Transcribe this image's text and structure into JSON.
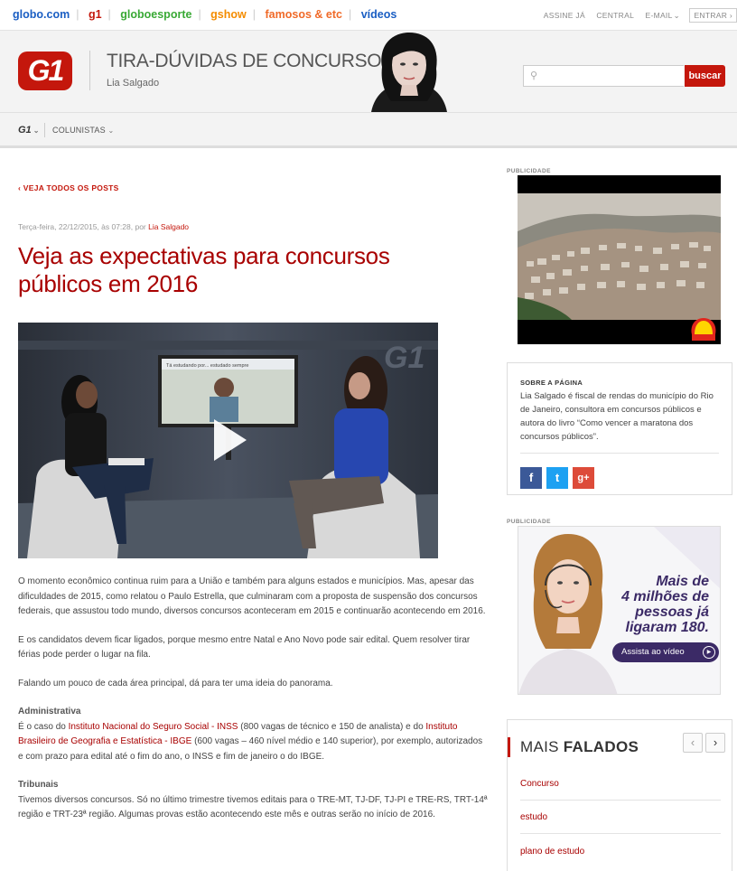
{
  "topbar": {
    "links": [
      {
        "label": "globo.com",
        "color": "#1a5ec3"
      },
      {
        "label": "g1",
        "color": "#c4170c"
      },
      {
        "label": "globoesporte",
        "color": "#39a935"
      },
      {
        "label": "gshow",
        "color": "#f48c00"
      },
      {
        "label": "famosos & etc",
        "color": "#f06a28"
      },
      {
        "label": "vídeos",
        "color": "#1a5ec3"
      }
    ],
    "right": [
      "ASSINE JÁ",
      "CENTRAL",
      "E-MAIL",
      "ENTRAR"
    ]
  },
  "header": {
    "logo": "G1",
    "blog_title": "TIRA-DÚVIDAS DE CONCURSOS",
    "author": "Lia Salgado",
    "search_placeholder": "",
    "search_button": "buscar"
  },
  "nav": {
    "g1": "G1",
    "colunistas": "COLUNISTAS"
  },
  "post": {
    "back": "‹ VEJA TODOS OS POSTS",
    "meta_date": "Terça-feira, 22/12/2015, às 07:28, por ",
    "meta_author": "Lia Salgado",
    "headline": "Veja as expectativas para concursos públicos em 2016",
    "video_screen_text": "Tá estudando por... estudado sempre",
    "paragraphs": [
      "O momento econômico continua ruim para a União e também para alguns estados e municípios. Mas, apesar das dificuldades de 2015, como relatou o Paulo Estrella, que culminaram com a proposta de suspensão dos concursos federais, que assustou todo mundo, diversos concursos aconteceram em 2015 e continuarão acontecendo em 2016.",
      "E os candidatos devem ficar ligados, porque mesmo entre Natal e Ano Novo pode sair edital. Quem resolver tirar férias pode perder o lugar na fila.",
      "Falando um pouco de cada área principal, dá para ter uma ideia do panorama."
    ],
    "admin": {
      "heading": "Administrativa",
      "t1": "É o caso do ",
      "link1": "Instituto Nacional do Seguro Social - INSS",
      "t2": " (800 vagas de técnico e 150 de analista)  e do ",
      "link2": "Instituto Brasileiro de Geografia e Estatística - IBGE",
      "t3": " (600 vagas – 460 nível médio e 140 superior), por exemplo, autorizados e com prazo para edital até o fim do ano, o INSS e fim de janeiro o do IBGE."
    },
    "tribunais": {
      "heading": "Tribunais",
      "text": "Tivemos diversos concursos. Só no último trimestre tivemos editais para o TRE-MT, TJ-DF, TJ-PI e TRE-RS, TRT-14ª região e TRT-23ª região. Algumas provas estão acontecendo este mês e outras serão no início de 2016."
    }
  },
  "sidebar": {
    "pub_label": "PUBLICIDADE",
    "about_heading": "SOBRE A PÁGINA",
    "about_text": "Lia Salgado é fiscal de rendas do município do Rio de Janeiro, consultora em concursos públicos e autora do livro “Como vencer a maratona dos concursos públicos”.",
    "social": [
      {
        "icon": "facebook-icon",
        "glyph": "f",
        "color": "#3b5998"
      },
      {
        "icon": "twitter-icon",
        "glyph": "t",
        "color": "#1da1f2"
      },
      {
        "icon": "google-plus-icon",
        "glyph": "g+",
        "color": "#dd4b39"
      }
    ],
    "ad2_lines": [
      "Mais de",
      "4 milhões de",
      "pessoas já",
      "ligaram 180."
    ],
    "ad2_cta": "Assista ao vídeo",
    "mais_prefix": "MAIS ",
    "mais_bold": "FALADOS",
    "mais_items": [
      "Concurso",
      "estudo",
      "plano de estudo"
    ]
  }
}
